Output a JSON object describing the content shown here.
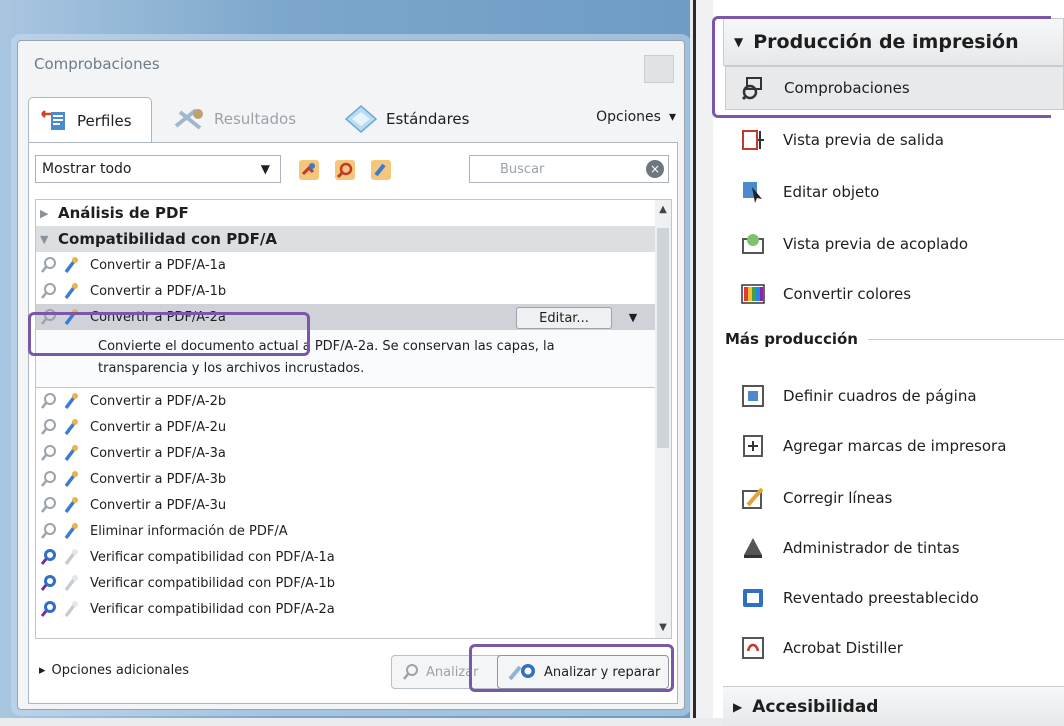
{
  "preflight": {
    "title": "Comprobaciones",
    "tabs": [
      {
        "label": "Perfiles",
        "active": true
      },
      {
        "label": "Resultados",
        "active": false
      },
      {
        "label": "Estándares",
        "active": false
      }
    ],
    "options_label": "Opciones",
    "show_select_value": "Mostrar todo",
    "search_placeholder": "Buscar",
    "groups": {
      "pdf_analysis": "Análisis de PDF",
      "pdfa_compat": "Compatibilidad con PDF/A"
    },
    "items": [
      "Convertir a PDF/A-1a",
      "Convertir a PDF/A-1b",
      "Convertir a PDF/A-2a",
      "Convertir a PDF/A-2b",
      "Convertir a PDF/A-2u",
      "Convertir a PDF/A-3a",
      "Convertir a PDF/A-3b",
      "Convertir a PDF/A-3u",
      "Eliminar información de PDF/A",
      "Verificar compatibilidad con PDF/A-1a",
      "Verificar compatibilidad con PDF/A-1b",
      "Verificar compatibilidad con PDF/A-2a"
    ],
    "edit_label": "Editar...",
    "selected_description_line1": "Convierte el documento actual a PDF/A-2a. Se conservan las capas, la",
    "selected_description_line2": "transparencia y los archivos incrustados.",
    "more_options": "Opciones adicionales",
    "analyze_label": "Analizar",
    "analyze_fix_label": "Analizar y reparar"
  },
  "tools_panel": {
    "section_title": "Producción de impresión",
    "tools": [
      "Comprobaciones",
      "Vista previa de salida",
      "Editar objeto",
      "Vista previa de acoplado",
      "Convertir colores"
    ],
    "more_production_title": "Más producción",
    "more_tools": [
      "Definir cuadros de página",
      "Agregar marcas de impresora",
      "Corregir líneas",
      "Administrador de tintas",
      "Reventado preestablecido",
      "Acrobat Distiller"
    ],
    "accessibility_title": "Accesibilidad"
  },
  "colors": {
    "highlight": "#7b57a7",
    "accent_blue": "#2f6fc6"
  }
}
